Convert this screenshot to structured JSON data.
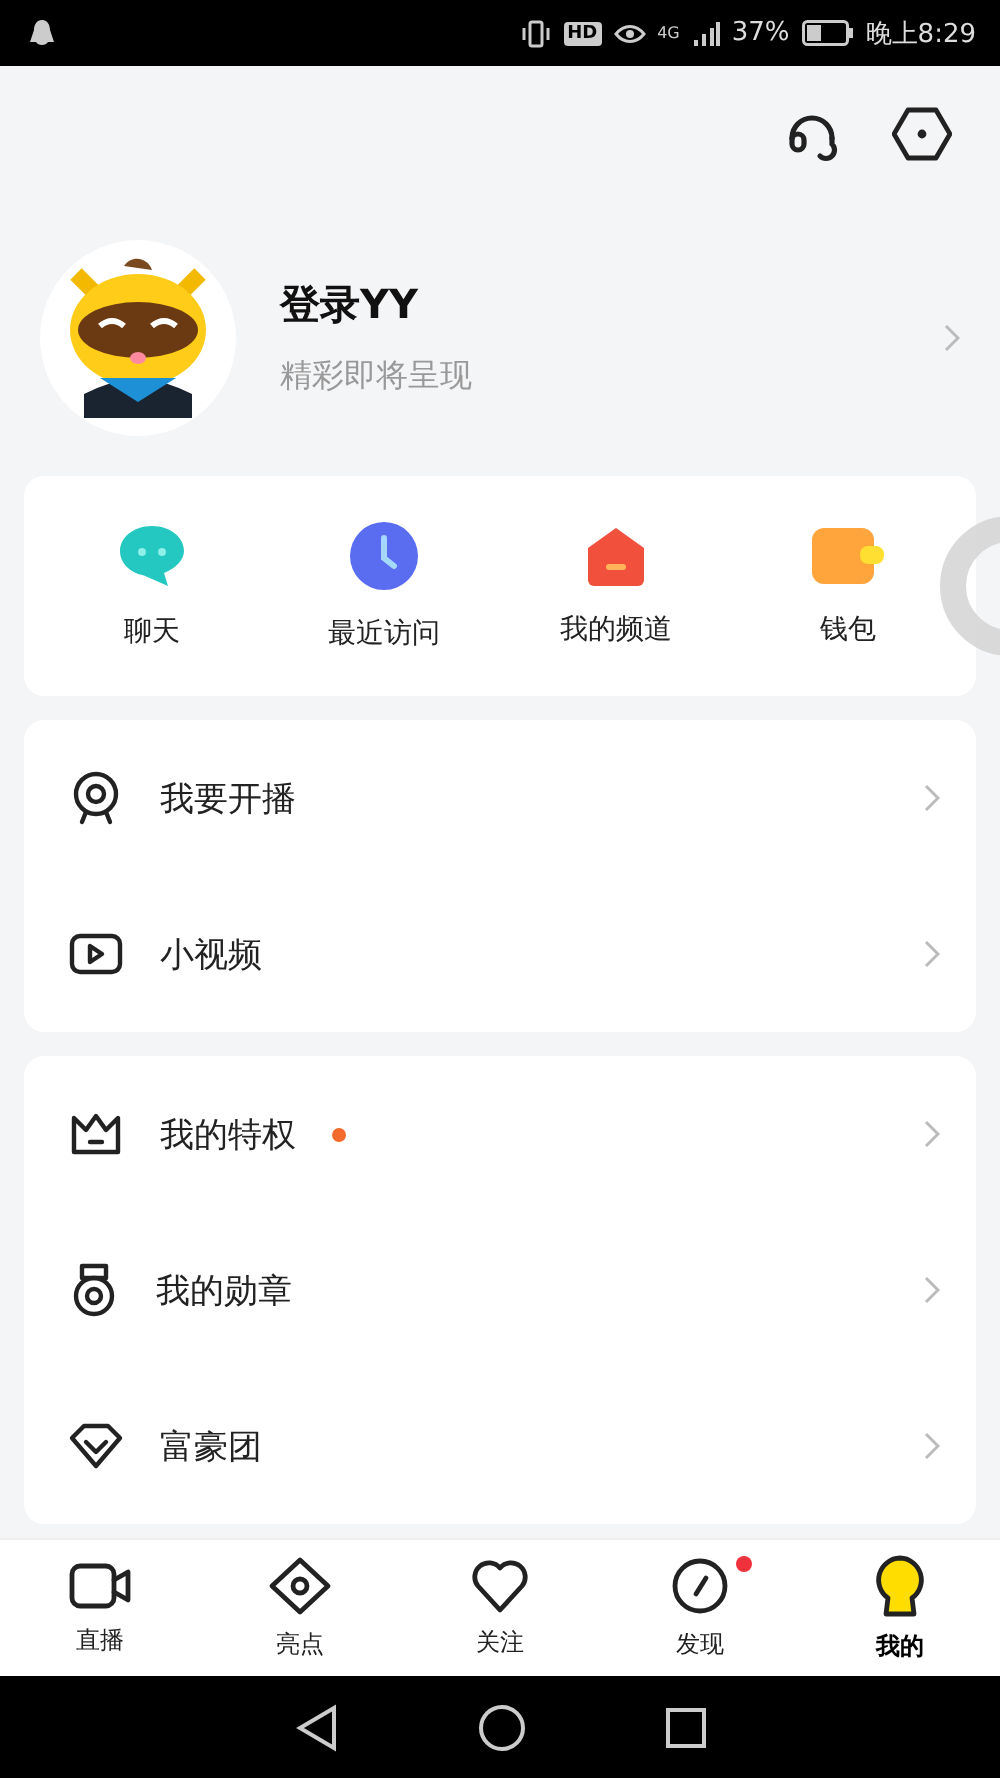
{
  "status_bar": {
    "hd": "HD",
    "network": "4G",
    "battery_text": "37%",
    "time": "晚上8:29"
  },
  "profile": {
    "title": "登录YY",
    "subtitle": "精彩即将呈现"
  },
  "shortcuts": [
    {
      "label": "聊天",
      "kind": "chat"
    },
    {
      "label": "最近访问",
      "kind": "clock"
    },
    {
      "label": "我的频道",
      "kind": "channel"
    },
    {
      "label": "钱包",
      "kind": "wallet"
    }
  ],
  "menu_groups": [
    [
      {
        "label": "我要开播",
        "kind": "webcam",
        "badge": false
      },
      {
        "label": "小视频",
        "kind": "video",
        "badge": false
      }
    ],
    [
      {
        "label": "我的特权",
        "kind": "crown",
        "badge": true
      },
      {
        "label": "我的勋章",
        "kind": "medal",
        "badge": false
      },
      {
        "label": "富豪团",
        "kind": "diamond",
        "badge": false
      }
    ]
  ],
  "tabs": [
    {
      "label": "直播",
      "kind": "camera",
      "selected": false,
      "badge": false
    },
    {
      "label": "亮点",
      "kind": "eye",
      "selected": false,
      "badge": false
    },
    {
      "label": "关注",
      "kind": "heart",
      "selected": false,
      "badge": false
    },
    {
      "label": "发现",
      "kind": "compass",
      "selected": false,
      "badge": true
    },
    {
      "label": "我的",
      "kind": "bulb",
      "selected": true,
      "badge": false
    }
  ]
}
